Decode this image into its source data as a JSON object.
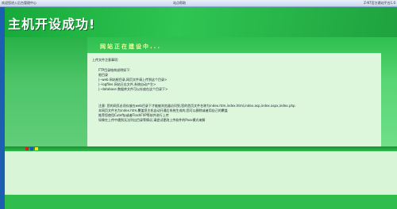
{
  "top_bar": {
    "left": "欢迎您进入后台管理中心",
    "center": "站点帮助",
    "right": "Z-NT官方建站平台1.0"
  },
  "banner": {
    "title": "主机开设成功!"
  },
  "construction": "网站正在建设中...",
  "notice": {
    "heading": "上传文件注意事项:",
    "lines": [
      "FTP目录结构说明如下:",
      "根目录",
      "|--web 网站根目录,网页文件请上传到这个目录>",
      "|--logfiles 网站日志文件,系统自动产生>",
      "|--database 数据库文件可以存放在这个目录下>"
    ],
    "tips": [
      "注意: 您的网页必须存放在web目录下才能被浏览器访问到,您的首页文件名称为index.htm,index.html,index.asp,index.aspx,index.php",
      "本网页文件名为index.htm,覆盖您主机自动开通后系统生成的,您可以删除或者用自己的覆盖",
      "推荐您使用Cuteftp或者FlashFXP等软件进行上传",
      "如果在上传中遇到无法列出目录等情况,请尝试更改上传软件的Pasv模式来解"
    ]
  },
  "colors": {
    "banner": "#2fc552",
    "panel": "#dcf7dc",
    "accent_text": "#f3ff9b",
    "square_red": "#d42020",
    "square_blue": "#1e4fcf",
    "square_yellow": "#f2e21f"
  }
}
